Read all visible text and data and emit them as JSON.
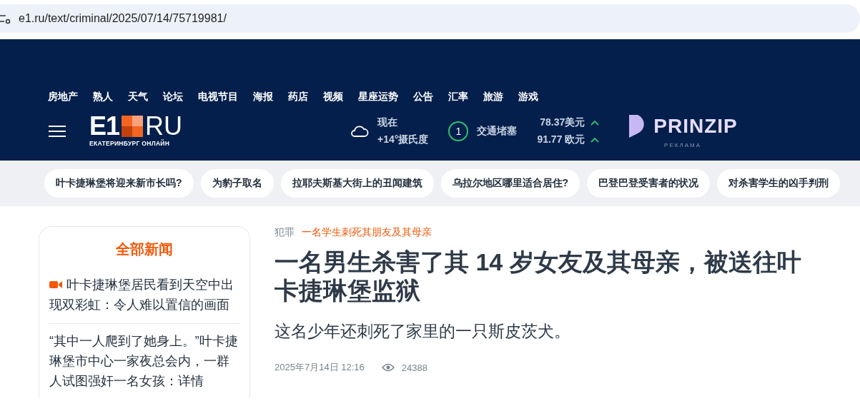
{
  "address_bar": {
    "url": "e1.ru/text/criminal/2025/07/14/75719981/"
  },
  "nav": [
    "房地产",
    "熟人",
    "天气",
    "论坛",
    "电视节目",
    "海报",
    "药店",
    "视频",
    "星座运势",
    "公告",
    "汇率",
    "旅游",
    "游戏"
  ],
  "logo": {
    "mark": "E1",
    "domain": "RU",
    "tagline": "ЕКАТЕРИНБУРГ ОНЛАЙН"
  },
  "weather": {
    "label": "现在",
    "temp": "+14°摄氏度"
  },
  "traffic": {
    "score": "1",
    "label": "交通堵塞"
  },
  "rates": [
    {
      "value": "78.37美元",
      "rising": true
    },
    {
      "value": "91.77 欧元",
      "rising": true
    }
  ],
  "ad": {
    "brand": "PRINZIP",
    "label": "РЕКЛАМА"
  },
  "topics": [
    "叶卡捷琳堡将迎来新市长吗?",
    "为豹子取名",
    "拉耶夫斯基大街上的丑闻建筑",
    "乌拉尔地区哪里适合居住?",
    "巴登巴登受害者的状况",
    "对杀害学生的凶手判刑"
  ],
  "sidebar": {
    "title": "全部新闻",
    "items": [
      {
        "kind": "video",
        "text": "叶卡捷琳堡居民看到天空中出现双彩虹：令人难以置信的画面"
      },
      {
        "kind": "text",
        "text": "“其中一人爬到了她身上。”叶卡捷琳堡市中心一家夜总会内，一群人试图强奸一名女孩：详情"
      }
    ]
  },
  "article": {
    "rubric": "犯罪",
    "tag": "一名学生刺死其朋友及其母亲",
    "title": "一名男生杀害了其 14 岁女友及其母亲，被送往叶卡捷琳堡监狱",
    "lead": "这名少年还刺死了家里的一只斯皮茨犬。",
    "date": "2025年7月14日 12:16",
    "views": "24388"
  }
}
